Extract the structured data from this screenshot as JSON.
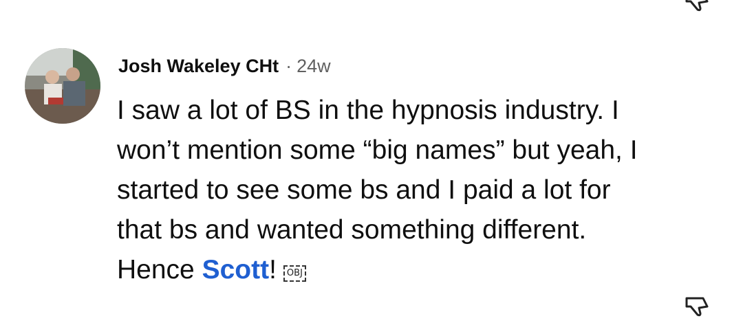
{
  "comment": {
    "author": "Josh Wakeley CHt",
    "separator": "·",
    "time_ago": "24w",
    "text_lines": [
      "I saw a lot of BS in the hypnosis industry. I",
      "won’t mention some “big names” but yeah, I",
      "started to see some bs and I paid a lot for",
      "that bs and wanted something different."
    ],
    "last_line_prefix": "Hence ",
    "mention": "Scott",
    "last_line_suffix": "!",
    "object_marker": "OBJ",
    "avatar_icon": "user-avatar-photo"
  },
  "icons": {
    "top": "dislike-icon",
    "bottom": "dislike-icon"
  },
  "colors": {
    "mention": "#1f5fd1",
    "secondary_text": "#606060",
    "primary_text": "#0f0f0f"
  }
}
